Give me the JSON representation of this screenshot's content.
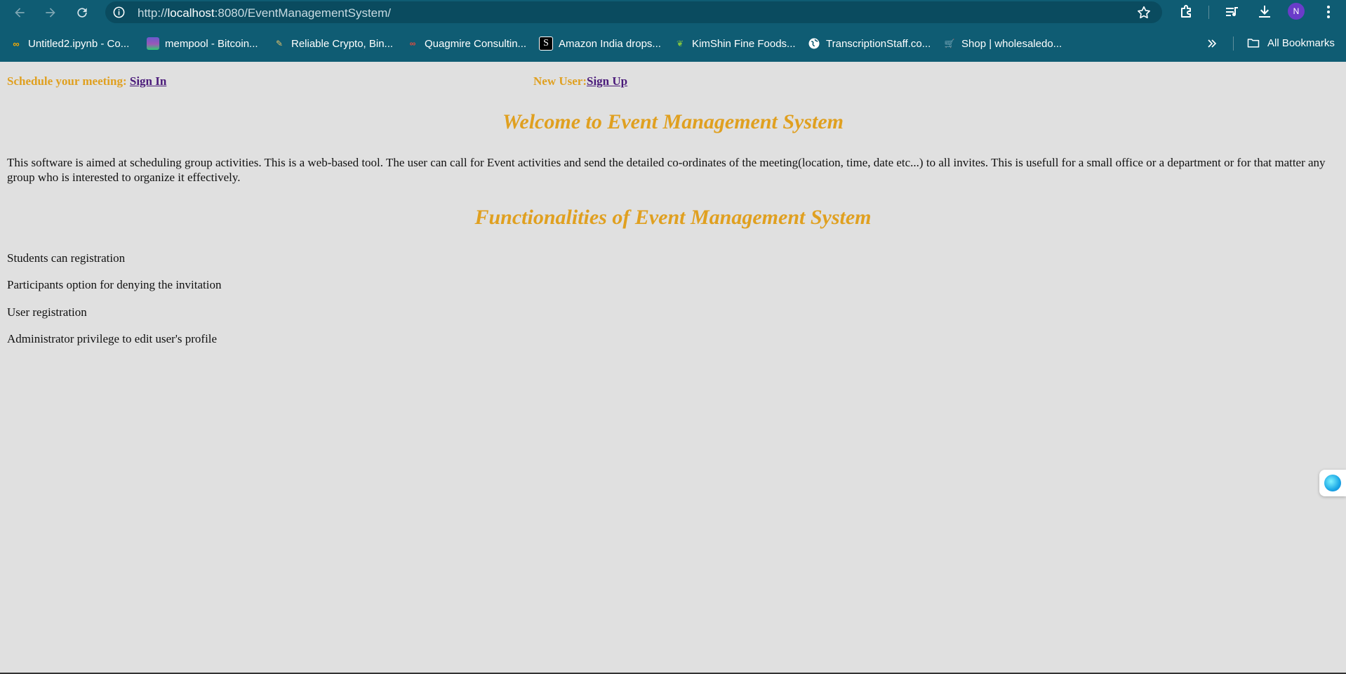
{
  "browser": {
    "url_prefix": "http://",
    "url_host": "localhost",
    "url_rest": ":8080/EventManagementSystem/",
    "profile_initial": "N",
    "bookmarks": [
      {
        "label": "Untitled2.ipynb - Co...",
        "icon": "colab-icon"
      },
      {
        "label": "mempool - Bitcoin...",
        "icon": "mempool-icon"
      },
      {
        "label": "Reliable Crypto, Bin...",
        "icon": "crypto-icon"
      },
      {
        "label": "Quagmire Consultin...",
        "icon": "quagmire-icon"
      },
      {
        "label": "Amazon India drops...",
        "icon": "s-icon"
      },
      {
        "label": "KimShin Fine Foods...",
        "icon": "leaf-icon"
      },
      {
        "label": "TranscriptionStaff.co...",
        "icon": "globe-icon"
      },
      {
        "label": "Shop | wholesaledo...",
        "icon": "cart-icon"
      }
    ],
    "all_bookmarks_label": "All Bookmarks"
  },
  "page": {
    "schedule_label": "Schedule your meeting: ",
    "sign_in_link": "Sign In",
    "new_user_label": "New User:",
    "sign_up_link": "Sign Up",
    "welcome_heading": "Welcome to Event Management System",
    "description": "This software is aimed at scheduling group activities. This is a web-based tool. The user can call for Event activities and send the detailed co-ordinates of the meeting(location, time, date etc...) to all invites. This is usefull for a small office or a department or for that matter any group who is interested to organize it effectively.",
    "functionalities_heading": "Functionalities of Event Management System",
    "features": [
      "Students can registration",
      "Participants option for denying the invitation",
      "User registration",
      "Administrator privilege to edit user's profile"
    ]
  },
  "colors": {
    "chrome": "#0f5c73",
    "heading": "#e0a020",
    "link": "#4a1a7a",
    "background": "#e0e0e0"
  }
}
